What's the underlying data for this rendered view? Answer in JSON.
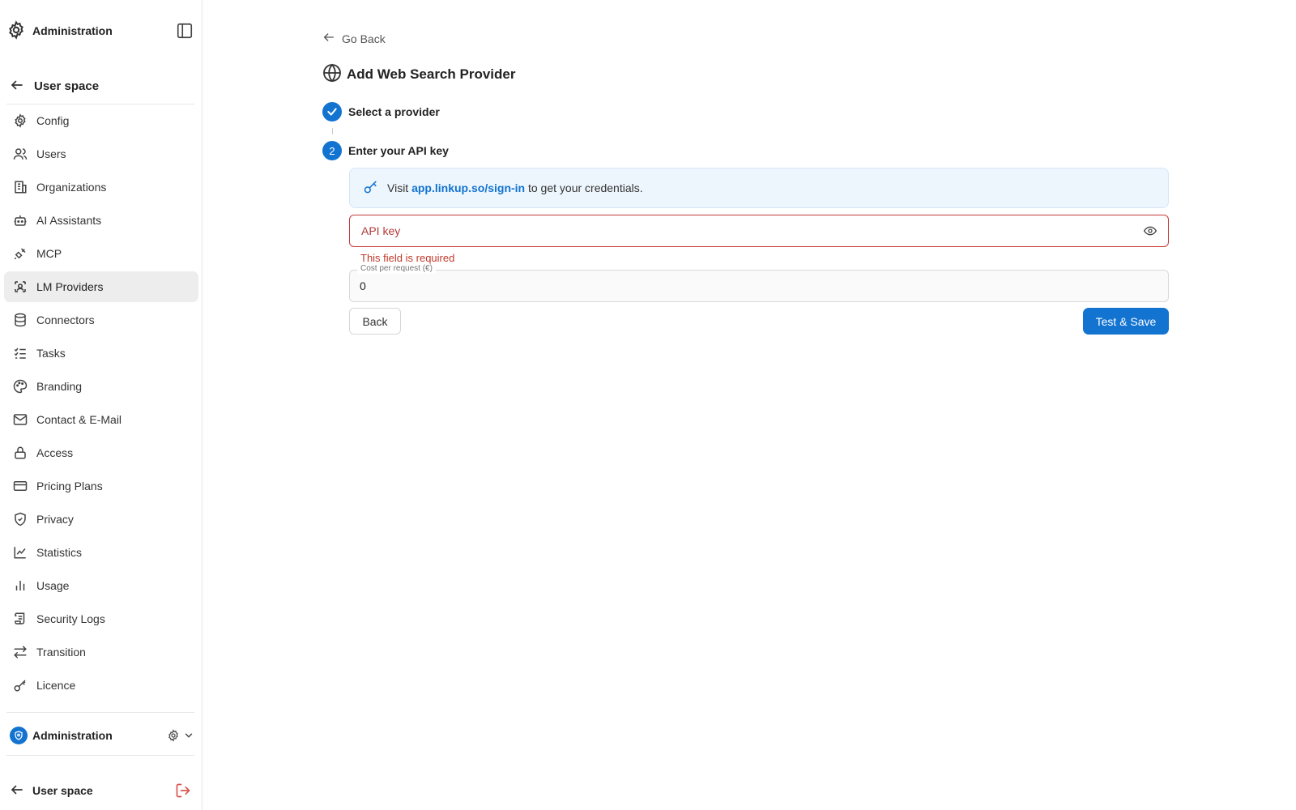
{
  "sidebar": {
    "header_title": "Administration",
    "toggle_icon": "sidebar-panel-icon",
    "back_label": "User space",
    "items": [
      {
        "label": "Config",
        "icon": "gear-icon"
      },
      {
        "label": "Users",
        "icon": "users-icon"
      },
      {
        "label": "Organizations",
        "icon": "building-icon"
      },
      {
        "label": "AI Assistants",
        "icon": "bot-icon"
      },
      {
        "label": "MCP",
        "icon": "plug-icon"
      },
      {
        "label": "LM Providers",
        "icon": "provider-icon",
        "active": true
      },
      {
        "label": "Connectors",
        "icon": "database-icon"
      },
      {
        "label": "Tasks",
        "icon": "tasks-icon"
      },
      {
        "label": "Branding",
        "icon": "palette-icon"
      },
      {
        "label": "Contact & E-Mail",
        "icon": "mail-icon"
      },
      {
        "label": "Access",
        "icon": "lock-icon"
      },
      {
        "label": "Pricing Plans",
        "icon": "credit-card-icon"
      },
      {
        "label": "Privacy",
        "icon": "shield-icon"
      },
      {
        "label": "Statistics",
        "icon": "line-chart-icon"
      },
      {
        "label": "Usage",
        "icon": "bar-chart-icon"
      },
      {
        "label": "Security Logs",
        "icon": "scroll-icon"
      },
      {
        "label": "Transition",
        "icon": "arrows-swap-icon"
      },
      {
        "label": "Licence",
        "icon": "key-icon"
      }
    ],
    "footer": {
      "admin_label": "Administration",
      "userspace_label": "User space"
    }
  },
  "main": {
    "go_back": "Go Back",
    "title": "Add Web Search Provider",
    "steps": [
      {
        "label": "Select a provider",
        "status": "done"
      },
      {
        "number": "2",
        "label": "Enter your API key",
        "status": "current"
      }
    ],
    "info": {
      "prefix": "Visit",
      "link": "app.linkup.so/sign-in",
      "suffix": "to get your credentials."
    },
    "api_key": {
      "placeholder": "API key",
      "value": "",
      "error": "This field is required"
    },
    "cost": {
      "legend": "Cost per request (€)",
      "value": "0"
    },
    "buttons": {
      "back": "Back",
      "save": "Test & Save"
    }
  },
  "colors": {
    "accent": "#1273d1",
    "error": "#c0392b",
    "active_bg": "#ededee",
    "info_bg": "#eef6fd"
  }
}
